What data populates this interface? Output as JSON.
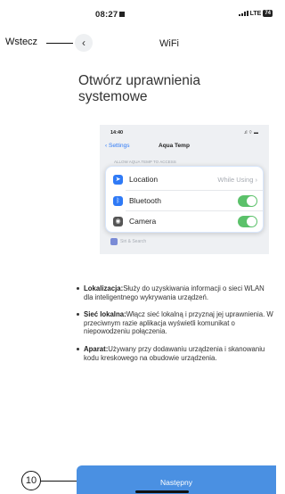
{
  "status_bar": {
    "time": "08:27",
    "network": "LTE",
    "battery": "74"
  },
  "annotations": {
    "back_label": "Wstecz",
    "step_number": "10"
  },
  "header": {
    "title": "WiFi"
  },
  "page": {
    "heading": "Otwórz uprawnienia systemowe"
  },
  "example_screenshot": {
    "time": "14:40",
    "back_label": "Settings",
    "title": "Aqua Temp",
    "section_label": "ALLOW AQUA TEMP TO ACCESS",
    "rows": [
      {
        "label": "Location",
        "value": "While Using",
        "icon": "location-arrow-icon",
        "icon_color": "#2f7af6"
      },
      {
        "label": "Bluetooth",
        "icon": "bluetooth-icon",
        "icon_color": "#2f7af6",
        "toggle": "on"
      },
      {
        "label": "Camera",
        "icon": "camera-icon",
        "icon_color": "#555555",
        "toggle": "on"
      }
    ],
    "siri_label": "Siri & Search"
  },
  "bullets": [
    {
      "title": "Lokalizacja:",
      "text": "Służy do uzyskiwania informacji o sieci WLAN dla inteligentnego wykrywania urządzeń."
    },
    {
      "title": "Sieć lokalna:",
      "text": "Włącz sieć lokalną i przyznaj jej uprawnienia. W przeciwnym razie aplikacja wyświetli komunikat o niepowodzeniu połączenia."
    },
    {
      "title": "Aparat:",
      "text": "Używany przy dodawaniu urządzenia i skanowaniu kodu kreskowego na obudowie urządzenia."
    }
  ],
  "footer": {
    "next_label": "Następny"
  },
  "colors": {
    "accent": "#4a90e2",
    "toggle_on": "#5bc16a"
  }
}
